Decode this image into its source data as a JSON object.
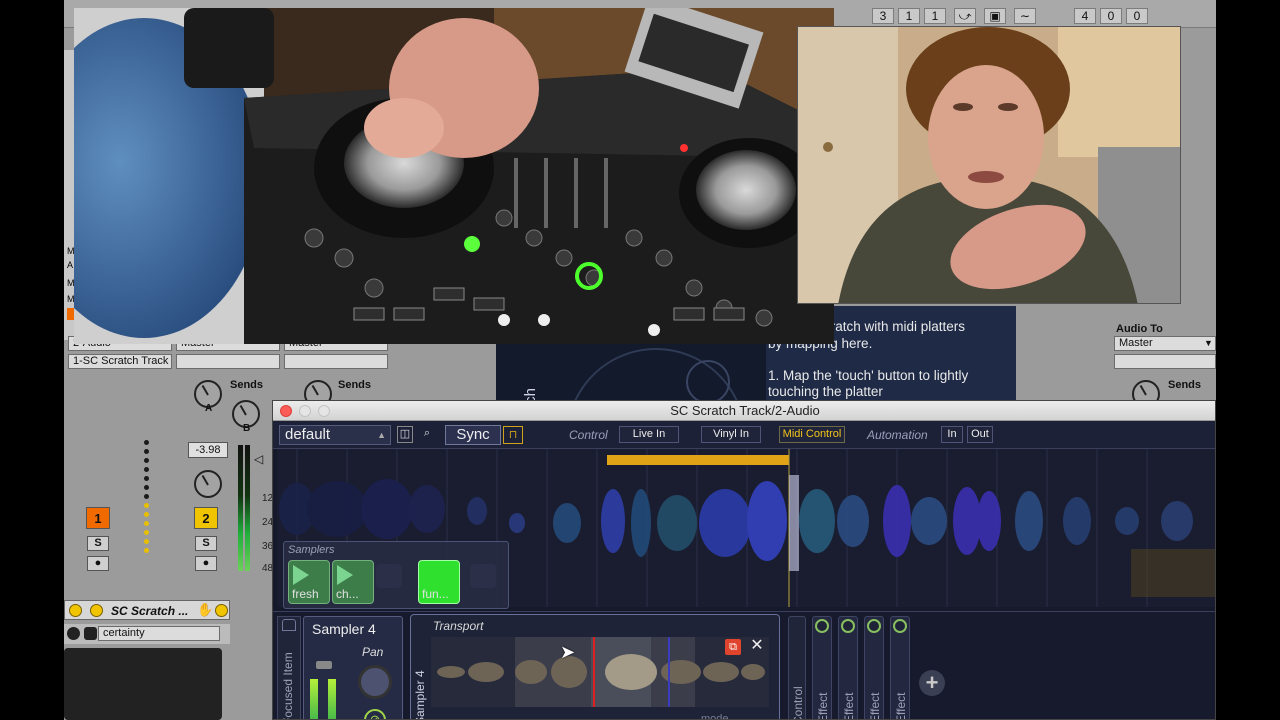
{
  "ableton": {
    "transport_numbers_left": [
      "3",
      "1",
      "1"
    ],
    "transport_numbers_right": [
      "4",
      "0",
      "0"
    ],
    "routing": {
      "input_value": "2-Audio",
      "track_name": "1-SC Scratch Track",
      "master_a": "Master",
      "master_b": "Master"
    },
    "sends_label": "Sends",
    "knob_a": "A",
    "knob_b": "B",
    "volume_value": "-3.98",
    "track1_number": "1",
    "track2_number": "2",
    "solo_label": "S",
    "meter_scale_1": "12",
    "meter_scale_2": "24",
    "meter_scale_3": "36",
    "meter_scale_4": "48",
    "left_markers": [
      "M",
      "A",
      "M",
      "M",
      "M"
    ],
    "device_title": "SC Scratch ...",
    "certainty_field": "certainty",
    "audio_to_label": "Audio To",
    "audio_to_value": "Master"
  },
  "instructions": {
    "line1": "cratch with midi platters",
    "line2": "by mapping here.",
    "line3": "1. Map the 'touch' button to lightly",
    "line4": "touching the platter",
    "side_label": "tch"
  },
  "scratch_window": {
    "title": "SC Scratch Track/2-Audio",
    "preset": "default",
    "sync_label": "Sync",
    "control_label": "Control",
    "live_in": "Live In",
    "vinyl_in": "Vinyl In",
    "midi_control": "Midi Control",
    "automation_label": "Automation",
    "in_label": "In",
    "out_label": "Out",
    "samplers_label": "Samplers",
    "pads": [
      "fresh",
      "ch...",
      "fun..."
    ],
    "focused_item_label": "Focused Item",
    "sampler_name": "Sampler 4",
    "pan_label": "Pan",
    "transport_label": "Transport",
    "transport_side_label": "Sampler 4",
    "control_col_label": "Control",
    "effect_labels": [
      "Effect",
      "Effect",
      "Effect",
      "Effect"
    ],
    "plus_label": "+",
    "mode_label": "mode"
  },
  "colors": {
    "accent_orange": "#f06a00",
    "accent_yellow": "#f1c400",
    "pad_green": "#2fe02f"
  }
}
